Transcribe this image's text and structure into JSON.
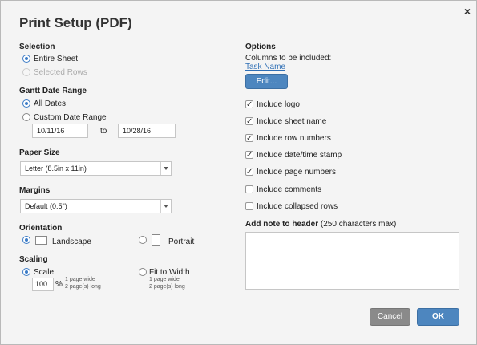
{
  "dialog": {
    "title": "Print Setup (PDF)",
    "close_glyph": "×"
  },
  "selection": {
    "heading": "Selection",
    "options": [
      {
        "label": "Entire Sheet",
        "selected": true,
        "enabled": true
      },
      {
        "label": "Selected Rows",
        "selected": false,
        "enabled": false
      }
    ]
  },
  "gantt": {
    "heading": "Gantt Date Range",
    "options": [
      {
        "label": "All Dates",
        "selected": true
      },
      {
        "label": "Custom Date Range",
        "selected": false
      }
    ],
    "start_date": "10/11/16",
    "to_label": "to",
    "end_date": "10/28/16"
  },
  "paper_size": {
    "heading": "Paper Size",
    "value": "Letter (8.5in x 11in)"
  },
  "margins": {
    "heading": "Margins",
    "value": "Default (0.5\")"
  },
  "orientation": {
    "heading": "Orientation",
    "landscape_label": "Landscape",
    "portrait_label": "Portrait",
    "selected": "Landscape"
  },
  "scaling": {
    "heading": "Scaling",
    "scale_label": "Scale",
    "scale_value": "100",
    "percent": "%",
    "scale_note_1": "1 page wide",
    "scale_note_2": "2 page(s) long",
    "fit_label": "Fit to Width",
    "fit_note_1": "1 page wide",
    "fit_note_2": "2 page(s) long",
    "selected": "Scale"
  },
  "options": {
    "heading": "Options",
    "columns_label": "Columns to be included:",
    "column_link": "Task Name",
    "edit_button": "Edit...",
    "checkboxes": [
      {
        "label": "Include logo",
        "checked": true
      },
      {
        "label": "Include sheet name",
        "checked": true
      },
      {
        "label": "Include row numbers",
        "checked": true
      },
      {
        "label": "Include date/time stamp",
        "checked": true
      },
      {
        "label": "Include page numbers",
        "checked": true
      },
      {
        "label": "Include comments",
        "checked": false
      },
      {
        "label": "Include collapsed rows",
        "checked": false
      }
    ],
    "check_glyph": "✓",
    "note_heading": "Add note to header",
    "note_hint": "(250 characters max)",
    "note_value": ""
  },
  "footer": {
    "cancel_label": "Cancel",
    "ok_label": "OK"
  },
  "colors": {
    "accent": "#4d86bf",
    "radio_accent": "#3b7bc6",
    "link": "#2f6fb5",
    "cancel": "#8a8a8a"
  }
}
